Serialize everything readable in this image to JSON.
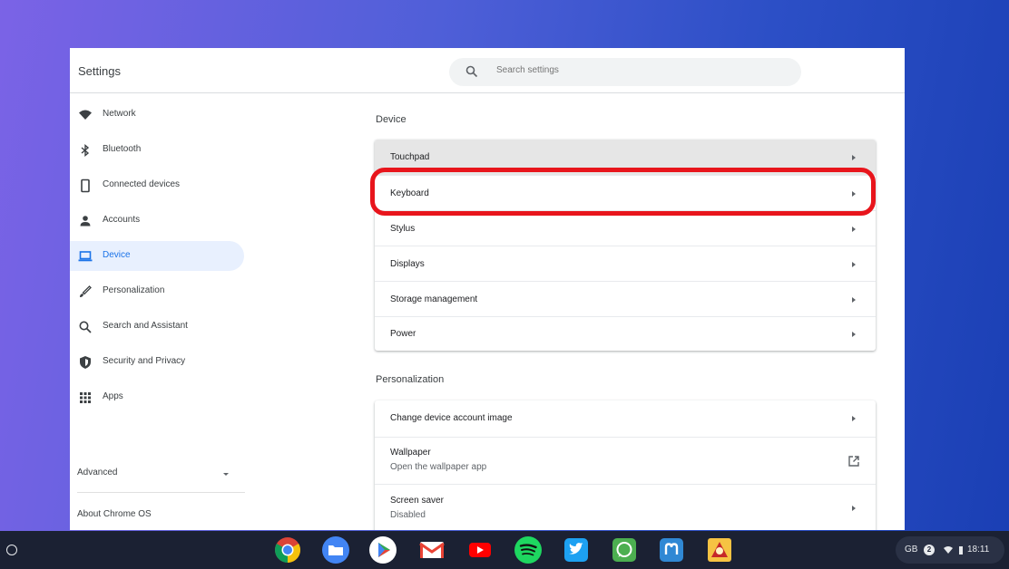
{
  "window": {
    "title": "Settings",
    "search": {
      "placeholder": "Search settings"
    }
  },
  "sidebar": {
    "items": [
      {
        "label": "Network",
        "icon": "wifi-icon"
      },
      {
        "label": "Bluetooth",
        "icon": "bluetooth-icon"
      },
      {
        "label": "Connected devices",
        "icon": "phone-icon"
      },
      {
        "label": "Accounts",
        "icon": "person-icon"
      },
      {
        "label": "Device",
        "icon": "laptop-icon",
        "active": true
      },
      {
        "label": "Personalization",
        "icon": "brush-icon"
      },
      {
        "label": "Search and Assistant",
        "icon": "search-icon"
      },
      {
        "label": "Security and Privacy",
        "icon": "shield-icon"
      },
      {
        "label": "Apps",
        "icon": "apps-grid-icon"
      }
    ],
    "advanced": "Advanced",
    "about": "About Chrome OS"
  },
  "main": {
    "device": {
      "title": "Device",
      "rows": [
        {
          "label": "Touchpad"
        },
        {
          "label": "Keyboard",
          "highlighted": true
        },
        {
          "label": "Stylus"
        },
        {
          "label": "Displays"
        },
        {
          "label": "Storage management"
        },
        {
          "label": "Power"
        }
      ]
    },
    "personalization": {
      "title": "Personalization",
      "rows": [
        {
          "label": "Change device account image"
        },
        {
          "label": "Wallpaper",
          "sublabel": "Open the wallpaper app",
          "external": true
        },
        {
          "label": "Screen saver",
          "sublabel": "Disabled"
        }
      ]
    }
  },
  "shelf": {
    "apps": [
      "chrome",
      "files",
      "play-store",
      "gmail",
      "youtube",
      "spotify",
      "twitter",
      "whatsapp",
      "mastodon",
      "game"
    ],
    "tray": {
      "keyboard_layout": "GB",
      "notifications": "2",
      "time": "18:11"
    }
  },
  "colors": {
    "accent": "#1a73e8",
    "highlight_ring": "#e8151c",
    "active_nav_bg": "#e8f0fe",
    "shelf_bg": "#1b2133"
  }
}
